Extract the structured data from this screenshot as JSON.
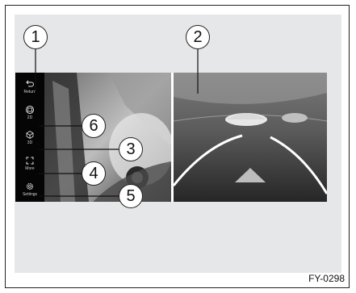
{
  "sidebar": {
    "items": [
      {
        "label": "Return",
        "icon": "return-icon"
      },
      {
        "label": "2D",
        "icon": "2d-view-icon"
      },
      {
        "label": "3D",
        "icon": "3d-view-icon"
      },
      {
        "label": "More",
        "icon": "expand-icon"
      },
      {
        "label": "Settings",
        "icon": "gear-icon"
      }
    ]
  },
  "callouts": [
    "1",
    "2",
    "3",
    "4",
    "5",
    "6"
  ],
  "figure_code": "FY-0298"
}
